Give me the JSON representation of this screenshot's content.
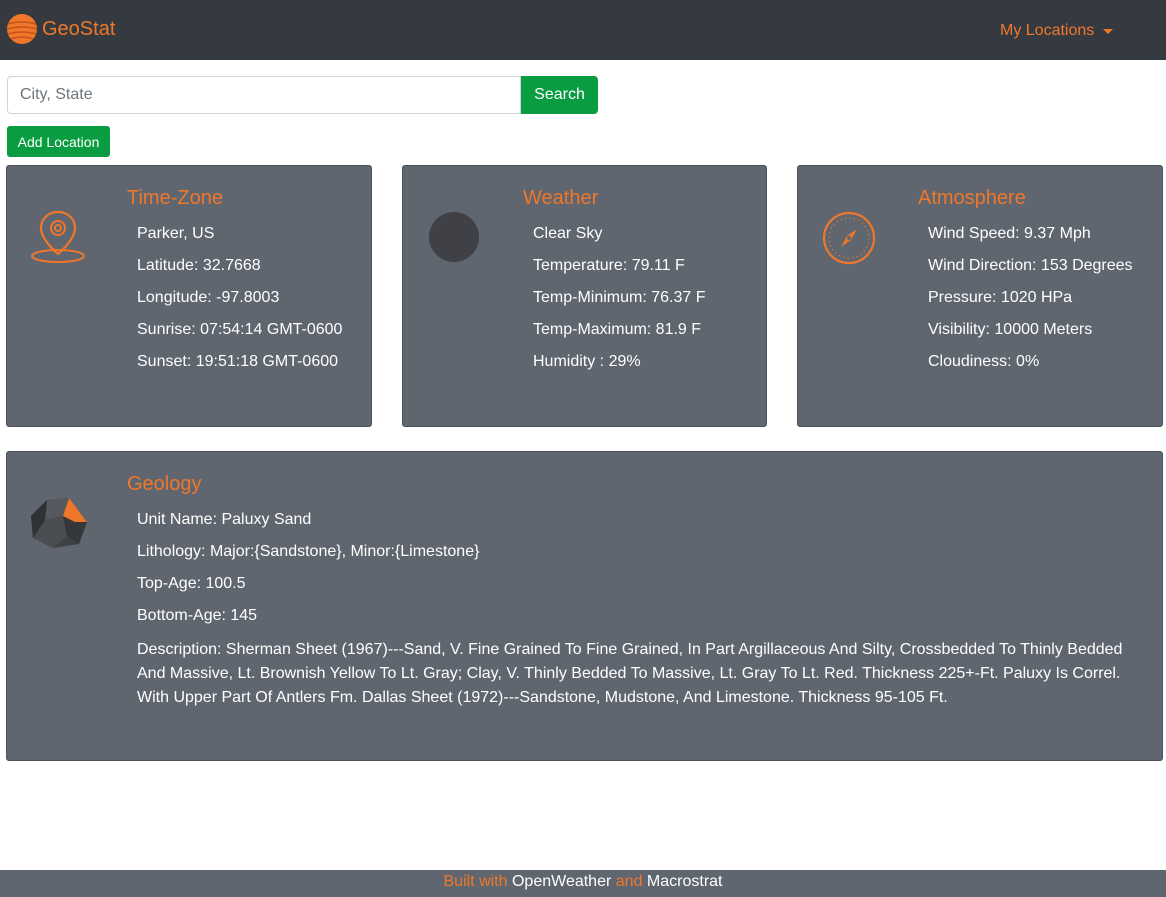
{
  "navbar": {
    "brand": "GeoStat",
    "dropdown_label": "My Locations"
  },
  "search": {
    "placeholder": "City, State",
    "button_label": "Search",
    "add_label": "Add Location"
  },
  "cards": {
    "timezone": {
      "title": "Time-Zone",
      "items": [
        "Parker, US",
        "Latitude: 32.7668",
        "Longitude: -97.8003",
        "Sunrise: 07:54:14 GMT-0600",
        "Sunset: 19:51:18 GMT-0600"
      ]
    },
    "weather": {
      "title": "Weather",
      "items": [
        "Clear Sky",
        "Temperature: 79.11 F",
        "Temp-Minimum: 76.37 F",
        "Temp-Maximum: 81.9 F",
        "Humidity : 29%"
      ]
    },
    "atmosphere": {
      "title": "Atmosphere",
      "items": [
        "Wind Speed: 9.37 Mph",
        "Wind Direction: 153 Degrees",
        "Pressure: 1020 HPa",
        "Visibility: 10000 Meters",
        "Cloudiness: 0%"
      ]
    },
    "geology": {
      "title": "Geology",
      "items": [
        "Unit Name: Paluxy Sand",
        "Lithology: Major:{Sandstone}, Minor:{Limestone}",
        "Top-Age: 100.5",
        "Bottom-Age: 145",
        "Description: Sherman Sheet (1967)---Sand, V. Fine Grained To Fine Grained, In Part Argillaceous And Silty, Crossbedded To Thinly Bedded And Massive, Lt. Brownish Yellow To Lt. Gray; Clay, V. Thinly Bedded To Massive, Lt. Gray To Lt. Red. Thickness 225+-Ft. Paluxy Is Correl. With Upper Part Of Antlers Fm. Dallas Sheet (1972)---Sandstone, Mudstone, And Limestone. Thickness 95-105 Ft."
      ]
    }
  },
  "footer": {
    "built_with": "Built with",
    "source1": "OpenWeather",
    "and": "and",
    "source2": "Macrostrat"
  },
  "colors": {
    "accent": "#f0772a",
    "navbar": "#343a40",
    "card": "#5f6670",
    "button": "#0a9c41"
  },
  "icons": {
    "brand": "globe-icon",
    "timezone": "location-pin-icon",
    "weather": "weather-moon-icon",
    "atmosphere": "compass-icon",
    "geology": "rock-icon"
  }
}
